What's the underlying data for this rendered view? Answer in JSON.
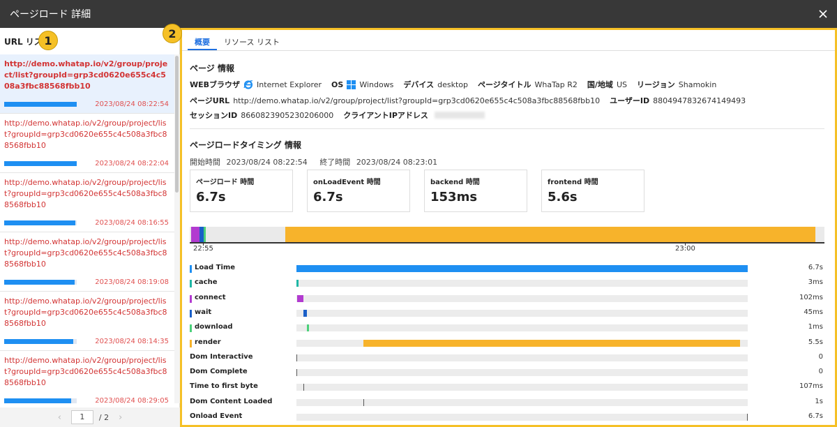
{
  "window": {
    "title": "ページロード 詳細"
  },
  "left": {
    "header": "URL リスト",
    "badge": "1",
    "items": [
      {
        "url": "http://demo.whatap.io/v2/group/project/list?groupId=grp3cd0620e655c4c508a3fbc88568fbb10",
        "date": "2023/08/24 08:22:54",
        "progress": 1.0
      },
      {
        "url": "http://demo.whatap.io/v2/group/project/list?groupId=grp3cd0620e655c4c508a3fbc88568fbb10",
        "date": "2023/08/24 08:22:04",
        "progress": 1.0
      },
      {
        "url": "http://demo.whatap.io/v2/group/project/list?groupId=grp3cd0620e655c4c508a3fbc88568fbb10",
        "date": "2023/08/24 08:16:55",
        "progress": 0.98
      },
      {
        "url": "http://demo.whatap.io/v2/group/project/list?groupId=grp3cd0620e655c4c508a3fbc88568fbb10",
        "date": "2023/08/24 08:19:08",
        "progress": 0.97
      },
      {
        "url": "http://demo.whatap.io/v2/group/project/list?groupId=grp3cd0620e655c4c508a3fbc88568fbb10",
        "date": "2023/08/24 08:14:35",
        "progress": 0.95
      },
      {
        "url": "http://demo.whatap.io/v2/group/project/list?groupId=grp3cd0620e655c4c508a3fbc88568fbb10",
        "date": "2023/08/24 08:29:05",
        "progress": 0.92
      }
    ],
    "pager": {
      "prev": "‹",
      "current": "1",
      "total": "/ 2",
      "next": "›"
    }
  },
  "right": {
    "badge": "2",
    "tabs": [
      {
        "label": "概要",
        "active": true
      },
      {
        "label": "リソース リスト",
        "active": false
      }
    ],
    "page_info": {
      "title": "ページ 情報",
      "browser_label": "WEBブラウザ",
      "browser": "Internet Explorer",
      "os_label": "OS",
      "os": "Windows",
      "device_label": "デバイス",
      "device": "desktop",
      "page_title_label": "ページタイトル",
      "page_title": "WhaTap R2",
      "country_label": "国/地域",
      "country": "US",
      "region_label": "リージョン",
      "region": "Shamokin",
      "url_label": "ページURL",
      "url": "http://demo.whatap.io/v2/group/project/list?groupId=grp3cd0620e655c4c508a3fbc88568fbb10",
      "user_label": "ユーザーID",
      "user": "8804947832674149493",
      "session_label": "セッションID",
      "session": "8660823905230206000",
      "client_ip_label": "クライアントIPアドレス"
    },
    "timing": {
      "title": "ページロードタイミング 情報",
      "start_label": "開始時間",
      "start": "2023/08/24 08:22:54",
      "end_label": "終了時間",
      "end": "2023/08/24 08:23:01",
      "cards": [
        {
          "label": "ページロード 時間",
          "value": "6.7s"
        },
        {
          "label": "onLoadEvent 時間",
          "value": "6.7s"
        },
        {
          "label": "backend 時間",
          "value": "153ms"
        },
        {
          "label": "frontend 時間",
          "value": "5.6s"
        }
      ],
      "axis_labels": [
        "22:55",
        "23:00"
      ]
    },
    "metrics": [
      {
        "name": "Load Time",
        "value": "6.7s",
        "color": "#1e8ff2",
        "start": 0.0,
        "end": 1.0
      },
      {
        "name": "cache",
        "value": "3ms",
        "color": "#1fb7a6",
        "start": 0.0,
        "end": 0.005
      },
      {
        "name": "connect",
        "value": "102ms",
        "color": "#b23bd0",
        "start": 0.001,
        "end": 0.016
      },
      {
        "name": "wait",
        "value": "45ms",
        "color": "#1a5fc8",
        "start": 0.016,
        "end": 0.023
      },
      {
        "name": "download",
        "value": "1ms",
        "color": "#4bd07a",
        "start": 0.023,
        "end": 0.027
      },
      {
        "name": "render",
        "value": "5.5s",
        "color": "#f7b32b",
        "start": 0.149,
        "end": 0.983
      },
      {
        "name": "Dom Interactive",
        "value": "0",
        "marker": 0.0
      },
      {
        "name": "Dom Complete",
        "value": "0",
        "marker": 0.0
      },
      {
        "name": "Time to first byte",
        "value": "107ms",
        "marker": 0.016
      },
      {
        "name": "Dom Content Loaded",
        "value": "1s",
        "marker": 0.149
      },
      {
        "name": "Onload Event",
        "value": "6.7s",
        "marker": 1.0
      }
    ]
  }
}
